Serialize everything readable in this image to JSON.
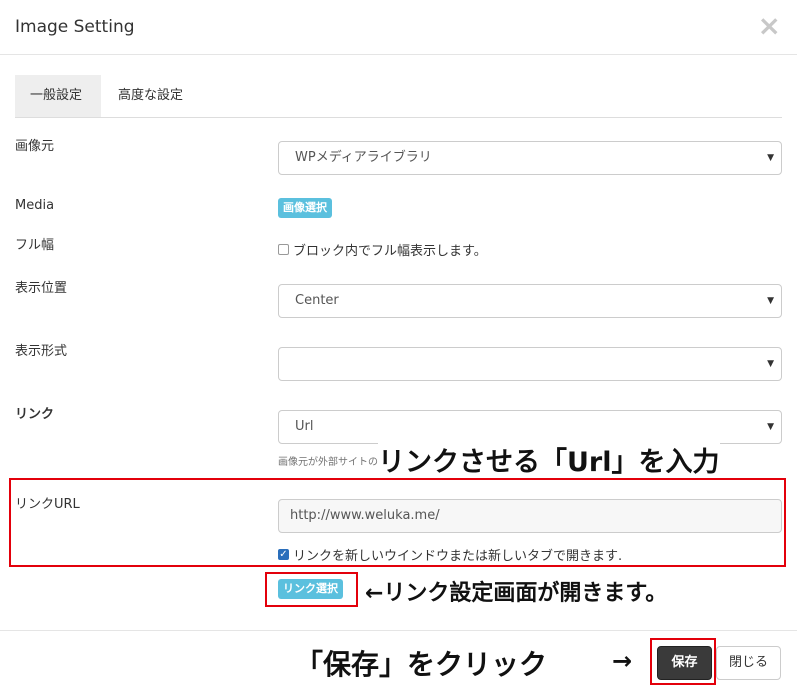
{
  "dialog": {
    "title": "Image Setting",
    "close_icon": "×"
  },
  "tabs": [
    {
      "label": "一般設定"
    },
    {
      "label": "高度な設定"
    }
  ],
  "form": {
    "source": {
      "label": "画像元",
      "value": "WPメディアライブラリ"
    },
    "media": {
      "label": "Media",
      "button": "画像選択"
    },
    "full_width": {
      "label": "フル幅",
      "checkbox": "ブロック内でフル幅表示します。",
      "checked": false
    },
    "position": {
      "label": "表示位置",
      "value": "Center"
    },
    "format": {
      "label": "表示形式",
      "value": ""
    },
    "link": {
      "label": "リンク",
      "value": "Url",
      "help": "画像元が外部サイトの場合"
    },
    "link_url": {
      "label": "リンクURL",
      "value": "http://www.weluka.me/",
      "new_window": "リンクを新しいウインドウまたは新しいタブで開きます.",
      "new_window_checked": true,
      "select_button": "リンク選択"
    }
  },
  "annotations": {
    "url_input": "リンクさせる「Url」を入力",
    "link_select": "←リンク設定画面が開きます。",
    "save_click": "「保存」をクリック",
    "arrow": "→"
  },
  "footer": {
    "save": "保存",
    "close": "閉じる"
  },
  "colors": {
    "highlight": "#e3000b",
    "badge": "#5bc0de",
    "save_bg": "#3a3a3a"
  }
}
